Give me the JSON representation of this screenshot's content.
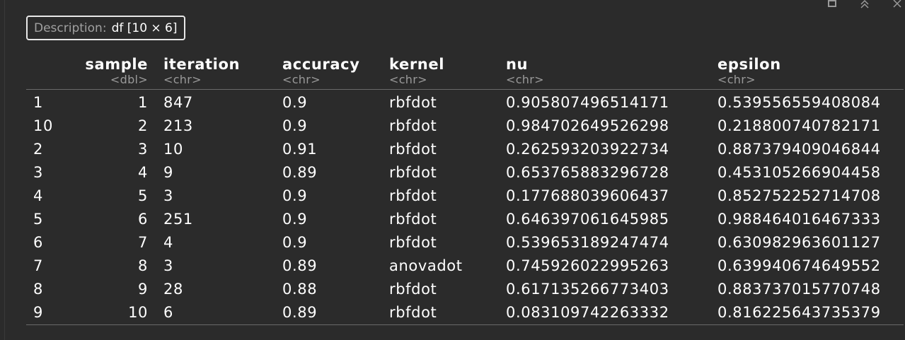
{
  "toolbar": {
    "icons": [
      "broom-icon",
      "collapse-up-icon",
      "close-icon"
    ]
  },
  "description": {
    "label": "Description:",
    "value": "df [10 × 6]"
  },
  "table": {
    "columns": [
      {
        "name": "",
        "type": ""
      },
      {
        "name": "sample",
        "type": "<dbl>"
      },
      {
        "name": "iteration",
        "type": "<chr>"
      },
      {
        "name": "accuracy",
        "type": "<chr>"
      },
      {
        "name": "kernel",
        "type": "<chr>"
      },
      {
        "name": "nu",
        "type": "<chr>"
      },
      {
        "name": "epsilon",
        "type": "<chr>"
      }
    ],
    "rows": [
      [
        "1",
        "1",
        "847",
        "0.9",
        "rbfdot",
        "0.905807496514171",
        "0.539556559408084"
      ],
      [
        "10",
        "2",
        "213",
        "0.9",
        "rbfdot",
        "0.984702649526298",
        "0.218800740782171"
      ],
      [
        "2",
        "3",
        "10",
        "0.91",
        "rbfdot",
        "0.262593203922734",
        "0.887379409046844"
      ],
      [
        "3",
        "4",
        "9",
        "0.89",
        "rbfdot",
        "0.653765883296728",
        "0.453105266904458"
      ],
      [
        "4",
        "5",
        "3",
        "0.9",
        "rbfdot",
        "0.177688039606437",
        "0.852752252714708"
      ],
      [
        "5",
        "6",
        "251",
        "0.9",
        "rbfdot",
        "0.646397061645985",
        "0.988464016467333"
      ],
      [
        "6",
        "7",
        "4",
        "0.9",
        "rbfdot",
        "0.539653189247474",
        "0.630982963601127"
      ],
      [
        "7",
        "8",
        "3",
        "0.89",
        "anovadot",
        "0.745926022995263",
        "0.639940674649552"
      ],
      [
        "8",
        "9",
        "28",
        "0.88",
        "rbfdot",
        "0.617135266773403",
        "0.883737015770748"
      ],
      [
        "9",
        "10",
        "6",
        "0.89",
        "rbfdot",
        "0.083109742263332",
        "0.816225643735379"
      ]
    ]
  }
}
